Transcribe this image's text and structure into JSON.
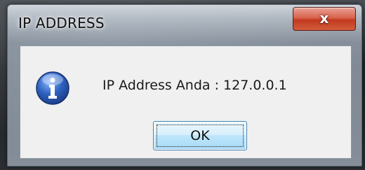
{
  "window": {
    "title": "IP ADDRESS",
    "close_glyph": "x"
  },
  "dialog": {
    "icon": "info-icon",
    "message": "IP Address Anda : 127.0.0.1",
    "ok_label": "OK"
  },
  "colors": {
    "close_button": "#c23a20",
    "ok_button": "#bee6fd",
    "info_icon": "#2f63c2"
  }
}
